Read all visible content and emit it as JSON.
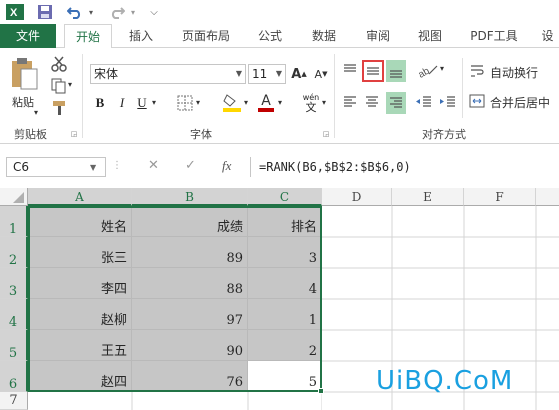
{
  "quick_access": {
    "app_icon": "excel-logo-icon",
    "save_icon": "save-icon",
    "undo_icon": "undo-icon",
    "redo_icon": "redo-icon"
  },
  "tabs": [
    {
      "label": "文件"
    },
    {
      "label": "开始"
    },
    {
      "label": "插入"
    },
    {
      "label": "页面布局"
    },
    {
      "label": "公式"
    },
    {
      "label": "数据"
    },
    {
      "label": "审阅"
    },
    {
      "label": "视图"
    },
    {
      "label": "PDF工具"
    },
    {
      "label": "设"
    }
  ],
  "ribbon": {
    "paste_label": "粘贴",
    "clipboard_label": "剪贴板",
    "font_name": "宋体",
    "font_size": "11",
    "font_group_label": "字体",
    "bold": "B",
    "italic": "I",
    "underline": "U",
    "wen": "wén",
    "wen_char": "文",
    "font_color_letter": "A",
    "align_group_label": "对齐方式",
    "wrap_text": "自动换行",
    "merge_center": "合并后居中",
    "colors": {
      "accent": "#217346",
      "font_color": "#c00000",
      "highlight": "#ffd700",
      "align_box": "#e04040"
    }
  },
  "formula_bar": {
    "name_box": "C6",
    "cancel": "✕",
    "enter": "✓",
    "fx": "fx",
    "formula": "=RANK(B6,$B$2:$B$6,0)"
  },
  "columns": [
    "A",
    "B",
    "C",
    "D",
    "E",
    "F"
  ],
  "rows": [
    "1",
    "2",
    "3",
    "4",
    "5",
    "6",
    "7"
  ],
  "table": [
    [
      "姓名",
      "成绩",
      "排名"
    ],
    [
      "张三",
      "89",
      "3"
    ],
    [
      "李四",
      "88",
      "4"
    ],
    [
      "赵柳",
      "97",
      "1"
    ],
    [
      "王五",
      "90",
      "2"
    ],
    [
      "赵四",
      "76",
      "5"
    ]
  ],
  "watermark": "UiBQ.CoM"
}
